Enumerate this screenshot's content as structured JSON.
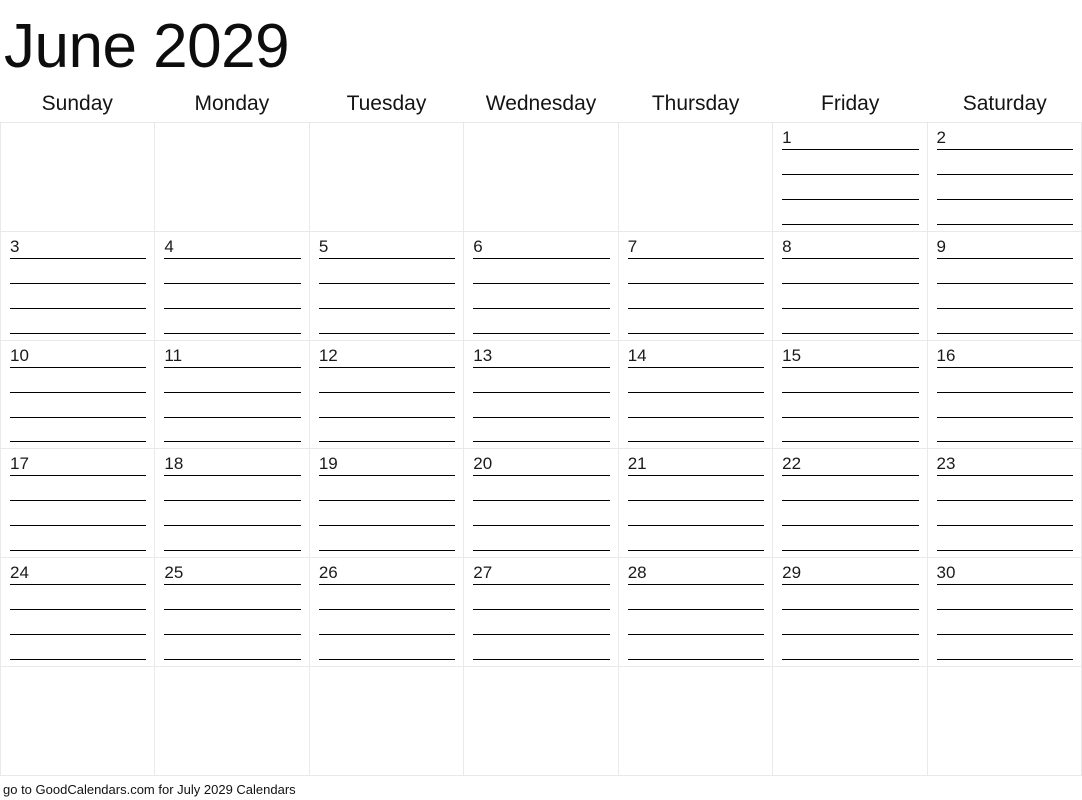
{
  "header": {
    "title": "June 2029",
    "month": "June",
    "year": "2029"
  },
  "weekdays": [
    {
      "label": "Sunday"
    },
    {
      "label": "Monday"
    },
    {
      "label": "Tuesday"
    },
    {
      "label": "Wednesday"
    },
    {
      "label": "Thursday"
    },
    {
      "label": "Friday"
    },
    {
      "label": "Saturday"
    }
  ],
  "calendar": {
    "lines_per_day": 4,
    "weeks": [
      [
        {
          "date": ""
        },
        {
          "date": ""
        },
        {
          "date": ""
        },
        {
          "date": ""
        },
        {
          "date": ""
        },
        {
          "date": "1"
        },
        {
          "date": "2"
        }
      ],
      [
        {
          "date": "3"
        },
        {
          "date": "4"
        },
        {
          "date": "5"
        },
        {
          "date": "6"
        },
        {
          "date": "7"
        },
        {
          "date": "8"
        },
        {
          "date": "9"
        }
      ],
      [
        {
          "date": "10"
        },
        {
          "date": "11"
        },
        {
          "date": "12"
        },
        {
          "date": "13"
        },
        {
          "date": "14"
        },
        {
          "date": "15"
        },
        {
          "date": "16"
        }
      ],
      [
        {
          "date": "17"
        },
        {
          "date": "18"
        },
        {
          "date": "19"
        },
        {
          "date": "20"
        },
        {
          "date": "21"
        },
        {
          "date": "22"
        },
        {
          "date": "23"
        }
      ],
      [
        {
          "date": "24"
        },
        {
          "date": "25"
        },
        {
          "date": "26"
        },
        {
          "date": "27"
        },
        {
          "date": "28"
        },
        {
          "date": "29"
        },
        {
          "date": "30"
        }
      ],
      [
        {
          "date": ""
        },
        {
          "date": ""
        },
        {
          "date": ""
        },
        {
          "date": ""
        },
        {
          "date": ""
        },
        {
          "date": ""
        },
        {
          "date": ""
        }
      ]
    ]
  },
  "footer": {
    "text": "go to GoodCalendars.com for July 2029 Calendars"
  },
  "colors": {
    "grid_line": "#e9e9e9",
    "writing_line": "#000000",
    "text": "#111111",
    "background": "#ffffff"
  }
}
